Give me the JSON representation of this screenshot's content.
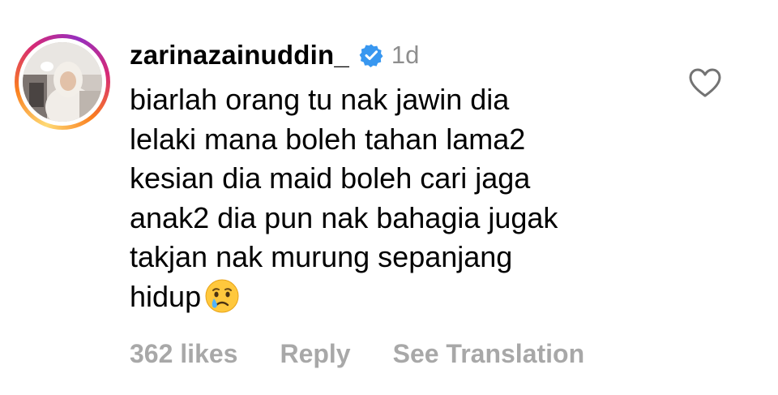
{
  "comment": {
    "username": "zarinazainuddin_",
    "verified": true,
    "timestamp": "1d",
    "lines": [
      "biarlah orang tu nak jawin dia",
      "lelaki mana boleh tahan lama2",
      "kesian dia maid boleh cari jaga",
      "anak2 dia pun nak bahagia jugak",
      "takjan nak murung sepanjang",
      "hidup"
    ],
    "emoji": "crying-face-icon",
    "likes": "362 likes",
    "reply_label": "Reply",
    "see_translation_label": "See Translation"
  },
  "icons": {
    "like": "heart-outline-icon",
    "verified": "verified-badge-icon"
  },
  "colors": {
    "text": "#000000",
    "muted": "#8e8e8e",
    "actions": "#a8a8a8",
    "verified_blue": "#3897f0"
  }
}
